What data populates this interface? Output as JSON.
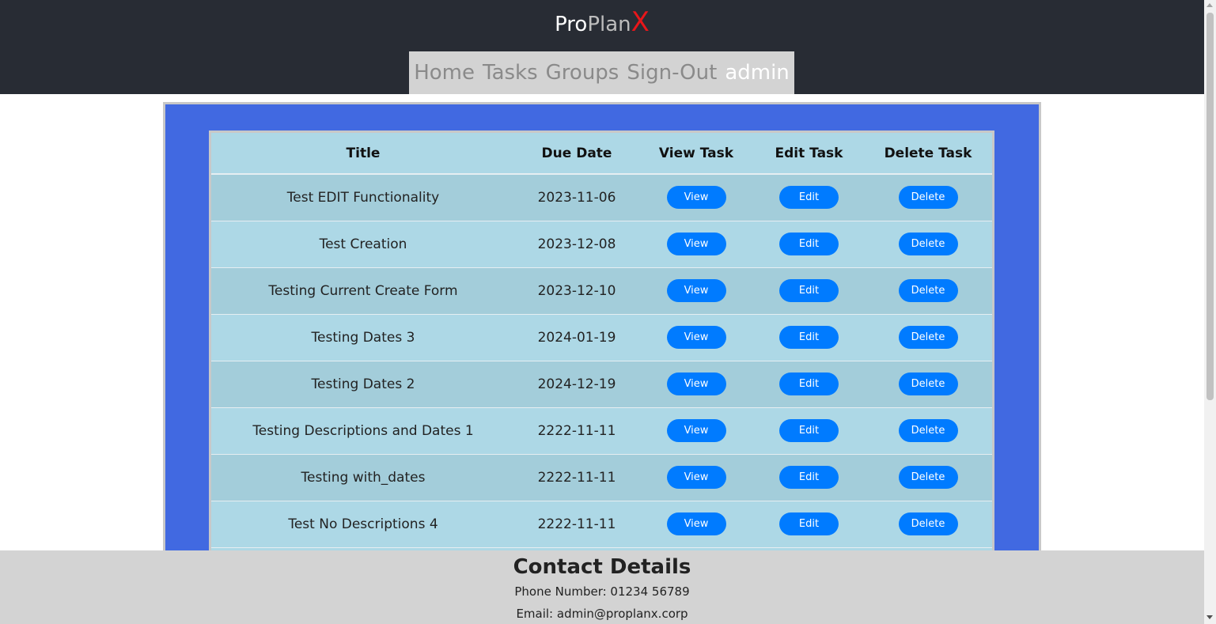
{
  "brand": {
    "pro": "Pro",
    "plan": "Plan",
    "x": "X"
  },
  "nav": {
    "home": "Home",
    "tasks": "Tasks",
    "groups": "Groups",
    "signout": "Sign-Out",
    "user": "admin"
  },
  "table": {
    "headers": [
      "Title",
      "Due Date",
      "View Task",
      "Edit Task",
      "Delete Task"
    ],
    "rows": [
      {
        "title": "Test EDIT Functionality",
        "due": "2023-11-06"
      },
      {
        "title": "Test Creation",
        "due": "2023-12-08"
      },
      {
        "title": "Testing Current Create Form",
        "due": "2023-12-10"
      },
      {
        "title": "Testing Dates 3",
        "due": "2024-01-19"
      },
      {
        "title": "Testing Dates 2",
        "due": "2024-12-19"
      },
      {
        "title": "Testing Descriptions and Dates 1",
        "due": "2222-11-11"
      },
      {
        "title": "Testing with_dates",
        "due": "2222-11-11"
      },
      {
        "title": "Test No Descriptions 4",
        "due": "2222-11-11"
      }
    ],
    "view_label": "View",
    "edit_label": "Edit",
    "delete_label": "Delete"
  },
  "footer": {
    "heading": "Contact Details",
    "phone": "Phone Number: 01234 56789",
    "email": "Email: admin@proplanx.corp"
  },
  "colors": {
    "header_bg": "#282c34",
    "nav_bg": "#d3d3d3",
    "panel_bg": "#4169e1",
    "table_bg": "#add8e6",
    "button_bg": "#007bff",
    "brand_x": "#e8161a"
  }
}
